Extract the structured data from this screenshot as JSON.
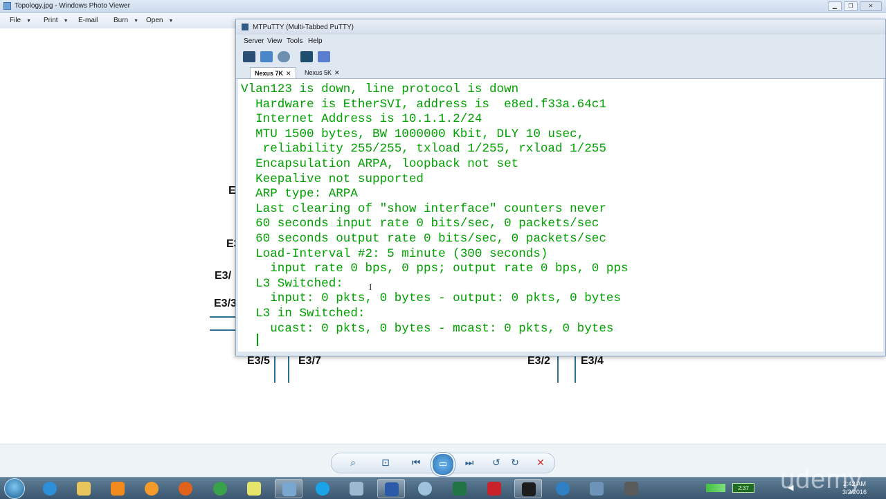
{
  "photo_viewer": {
    "title": "Topology.jpg - Windows Photo Viewer",
    "menu": [
      "File",
      "Print",
      "E-mail",
      "Burn",
      "Open"
    ],
    "controls": [
      "zoom-icon",
      "fit-icon",
      "previous-icon",
      "slideshow-icon",
      "next-icon",
      "rotate-left-icon",
      "rotate-right-icon",
      "delete-icon"
    ]
  },
  "topology": {
    "labels": [
      "E",
      "E3",
      "E3/",
      "E3/3",
      "E3/5",
      "E3/7",
      "E3/2",
      "E3/4"
    ]
  },
  "putty": {
    "title": "MTPuTTY (Multi-Tabbed PuTTY)",
    "menu": [
      "Server",
      "View",
      "Tools",
      "Help"
    ],
    "tabs": [
      {
        "label": "Nexus 7K",
        "active": true,
        "close": "✕"
      },
      {
        "label": "Nexus 5K",
        "active": false,
        "close": "✕"
      }
    ],
    "text_color": "#00a000",
    "terminal_lines": [
      "Vlan123 is down, line protocol is down",
      "  Hardware is EtherSVI, address is  e8ed.f33a.64c1",
      "  Internet Address is 10.1.1.2/24",
      "  MTU 1500 bytes, BW 1000000 Kbit, DLY 10 usec,",
      "   reliability 255/255, txload 1/255, rxload 1/255",
      "  Encapsulation ARPA, loopback not set",
      "  Keepalive not supported",
      "  ARP type: ARPA",
      "  Last clearing of \"show interface\" counters never",
      "  60 seconds input rate 0 bits/sec, 0 packets/sec",
      "  60 seconds output rate 0 bits/sec, 0 packets/sec",
      "  Load-Interval #2: 5 minute (300 seconds)",
      "    input rate 0 bps, 0 pps; output rate 0 bps, 0 pps",
      "  L3 Switched:",
      "    input: 0 pkts, 0 bytes - output: 0 pkts, 0 bytes",
      "  L3 in Switched:",
      "    ucast: 0 pkts, 0 bytes - mcast: 0 pkts, 0 bytes"
    ]
  },
  "taskbar": {
    "battery": "2:37",
    "time": "2:42 AM",
    "date": "3/2/2016",
    "watermark": "udemy"
  }
}
